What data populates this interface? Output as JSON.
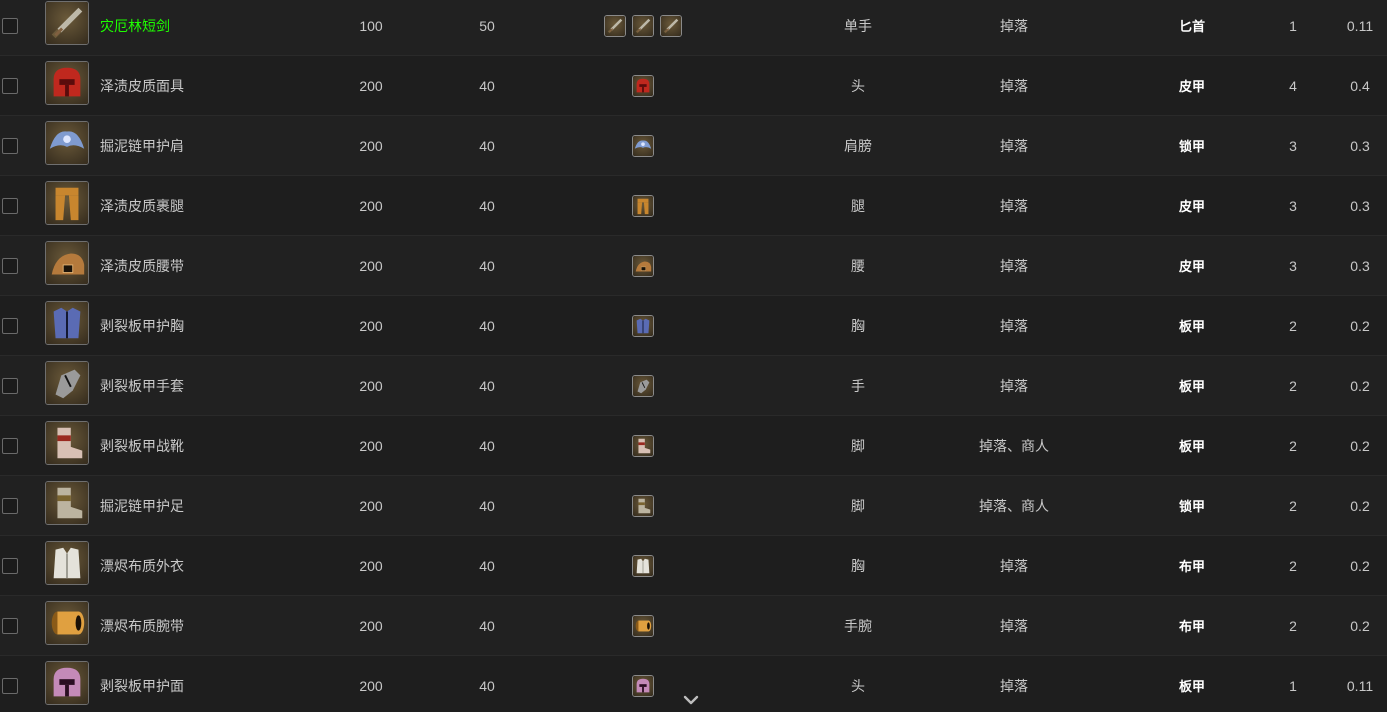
{
  "rows": [
    {
      "name": "灾厄林短剑",
      "name_color": "#1eff00",
      "v1": "100",
      "v2": "50",
      "slot": "单手",
      "source": "掉落",
      "armor_type": "匕首",
      "count": "1",
      "rate": "0.11",
      "icon": "dagger-icon",
      "mini_icons": 3,
      "palette": [
        "#3a3020",
        "#bdb8a8",
        "#6b5a3a"
      ]
    },
    {
      "name": "泽渍皮质面具",
      "v1": "200",
      "v2": "40",
      "slot": "头",
      "source": "掉落",
      "armor_type": "皮甲",
      "count": "4",
      "rate": "0.4",
      "icon": "helmet-icon",
      "mini_icons": 1,
      "palette": [
        "#5a0c0c",
        "#c0281e",
        "#1a0606"
      ]
    },
    {
      "name": "掘泥链甲护肩",
      "v1": "200",
      "v2": "40",
      "slot": "肩膀",
      "source": "掉落",
      "armor_type": "锁甲",
      "count": "3",
      "rate": "0.3",
      "icon": "shoulder-icon",
      "mini_icons": 1,
      "palette": [
        "#0d1430",
        "#7f9bd0",
        "#2b3f78"
      ]
    },
    {
      "name": "泽渍皮质裹腿",
      "v1": "200",
      "v2": "40",
      "slot": "腿",
      "source": "掉落",
      "armor_type": "皮甲",
      "count": "3",
      "rate": "0.3",
      "icon": "legs-icon",
      "mini_icons": 1,
      "palette": [
        "#3a240c",
        "#c8862e",
        "#7a4a18"
      ]
    },
    {
      "name": "泽渍皮质腰带",
      "v1": "200",
      "v2": "40",
      "slot": "腰",
      "source": "掉落",
      "armor_type": "皮甲",
      "count": "3",
      "rate": "0.3",
      "icon": "belt-icon",
      "mini_icons": 1,
      "palette": [
        "#1a1208",
        "#b57a3c",
        "#5e3c16"
      ]
    },
    {
      "name": "剥裂板甲护胸",
      "v1": "200",
      "v2": "40",
      "slot": "胸",
      "source": "掉落",
      "armor_type": "板甲",
      "count": "2",
      "rate": "0.2",
      "icon": "chest-icon",
      "mini_icons": 1,
      "palette": [
        "#10142c",
        "#5a6bb4",
        "#252e66"
      ]
    },
    {
      "name": "剥裂板甲手套",
      "v1": "200",
      "v2": "40",
      "slot": "手",
      "source": "掉落",
      "armor_type": "板甲",
      "count": "2",
      "rate": "0.2",
      "icon": "gloves-icon",
      "mini_icons": 1,
      "palette": [
        "#141414",
        "#9a9a9a",
        "#4a4a4a"
      ]
    },
    {
      "name": "剥裂板甲战靴",
      "v1": "200",
      "v2": "40",
      "slot": "脚",
      "source": "掉落、商人",
      "armor_type": "板甲",
      "count": "2",
      "rate": "0.2",
      "icon": "boots-icon",
      "mini_icons": 1,
      "palette": [
        "#2a1410",
        "#d8c0b4",
        "#9a2a20"
      ]
    },
    {
      "name": "掘泥链甲护足",
      "v1": "200",
      "v2": "40",
      "slot": "脚",
      "source": "掉落、商人",
      "armor_type": "锁甲",
      "count": "2",
      "rate": "0.2",
      "icon": "boots-icon",
      "mini_icons": 1,
      "palette": [
        "#1c1a14",
        "#bcb4a0",
        "#7a6430"
      ]
    },
    {
      "name": "漂烬布质外衣",
      "v1": "200",
      "v2": "40",
      "slot": "胸",
      "source": "掉落",
      "armor_type": "布甲",
      "count": "2",
      "rate": "0.2",
      "icon": "robe-icon",
      "mini_icons": 1,
      "palette": [
        "#3a3a36",
        "#e4e2da",
        "#9c9a90"
      ]
    },
    {
      "name": "漂烬布质腕带",
      "v1": "200",
      "v2": "40",
      "slot": "手腕",
      "source": "掉落",
      "armor_type": "布甲",
      "count": "2",
      "rate": "0.2",
      "icon": "bracer-icon",
      "mini_icons": 1,
      "palette": [
        "#1a1006",
        "#e0a040",
        "#8a5a18"
      ]
    },
    {
      "name": "剥裂板甲护面",
      "v1": "200",
      "v2": "40",
      "slot": "头",
      "source": "掉落",
      "armor_type": "板甲",
      "count": "1",
      "rate": "0.11",
      "icon": "helmet-icon",
      "mini_icons": 1,
      "palette": [
        "#2a0e22",
        "#c48ab8",
        "#6e2a5c"
      ]
    }
  ]
}
